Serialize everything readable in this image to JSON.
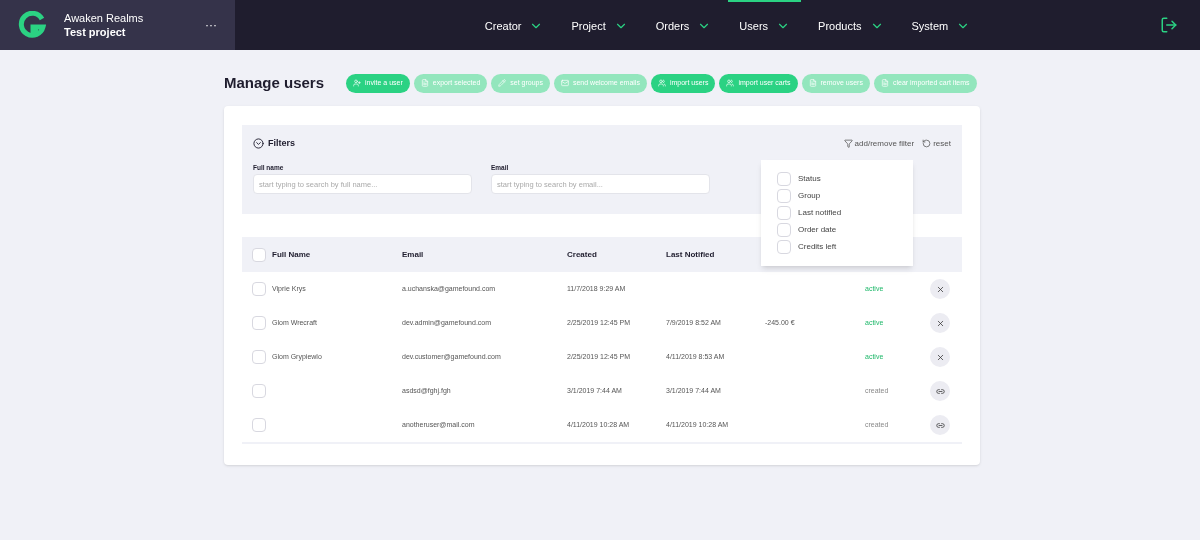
{
  "brand": {
    "company": "Awaken Realms",
    "project": "Test project",
    "more": "···"
  },
  "nav": [
    {
      "label": "Creator",
      "selected": false
    },
    {
      "label": "Project",
      "selected": false
    },
    {
      "label": "Orders",
      "selected": false
    },
    {
      "label": "Users",
      "selected": true
    },
    {
      "label": "Products",
      "selected": false
    },
    {
      "label": "System",
      "selected": false
    }
  ],
  "title": "Manage users",
  "actions": [
    {
      "label": "invite a user",
      "kind": "person",
      "disabled": false
    },
    {
      "label": "export selected",
      "kind": "file",
      "disabled": true
    },
    {
      "label": "set groups",
      "kind": "pencil",
      "disabled": true
    },
    {
      "label": "send welcome emails",
      "kind": "mail",
      "disabled": true
    },
    {
      "label": "import users",
      "kind": "people",
      "disabled": false
    },
    {
      "label": "import user carts",
      "kind": "people",
      "disabled": false
    },
    {
      "label": "remove users",
      "kind": "file",
      "disabled": true
    },
    {
      "label": "clear imported cart items",
      "kind": "file",
      "disabled": true
    }
  ],
  "filters": {
    "title": "Filters",
    "add_remove": "add/remove filter",
    "reset": "reset",
    "fields": [
      {
        "label": "Full name",
        "placeholder": "start typing to search by full name..."
      },
      {
        "label": "Email",
        "placeholder": "start typing to search by email..."
      }
    ],
    "menu": [
      {
        "label": "Status",
        "checked": false
      },
      {
        "label": "Group",
        "checked": false
      },
      {
        "label": "Last notified",
        "checked": false
      },
      {
        "label": "Order date",
        "checked": false
      },
      {
        "label": "Credits left",
        "checked": false
      }
    ]
  },
  "table": {
    "select_all": false,
    "columns": [
      "Full Name",
      "Email",
      "Created",
      "Last Notified"
    ],
    "rows": [
      {
        "selected": false,
        "name": "Viprie Krys",
        "email": "a.uchanska@gamefound.com",
        "created": "11/7/2018 9:29 AM",
        "notified": "",
        "column_5": "",
        "status": {
          "text": "active",
          "kind": "active"
        },
        "action": {
          "kind": "remove"
        }
      },
      {
        "selected": false,
        "name": "Glom Wrecraft",
        "email": "dev.admin@gamefound.com",
        "created": "2/25/2019 12:45 PM",
        "notified": "7/9/2019 8:52 AM",
        "column_5": "-245.00 €",
        "status": {
          "text": "active",
          "kind": "active"
        },
        "action": {
          "kind": "remove"
        }
      },
      {
        "selected": false,
        "name": "Glom Grypiewlo",
        "email": "dev.customer@gamefound.com",
        "created": "2/25/2019 12:45 PM",
        "notified": "4/11/2019 8:53 AM",
        "column_5": "",
        "status": {
          "text": "active",
          "kind": "active"
        },
        "action": {
          "kind": "remove"
        }
      },
      {
        "selected": false,
        "name": "",
        "email": "asdsd@fghj.fgh",
        "created": "3/1/2019 7:44 AM",
        "notified": "3/1/2019 7:44 AM",
        "column_5": "",
        "status": {
          "text": "created",
          "kind": "created"
        },
        "action": {
          "kind": "link"
        }
      },
      {
        "selected": false,
        "name": "",
        "email": "anotheruser@mail.com",
        "created": "4/11/2019 10:28 AM",
        "notified": "4/11/2019 10:28 AM",
        "column_5": "",
        "status": {
          "text": "created",
          "kind": "created"
        },
        "action": {
          "kind": "link"
        }
      }
    ]
  }
}
